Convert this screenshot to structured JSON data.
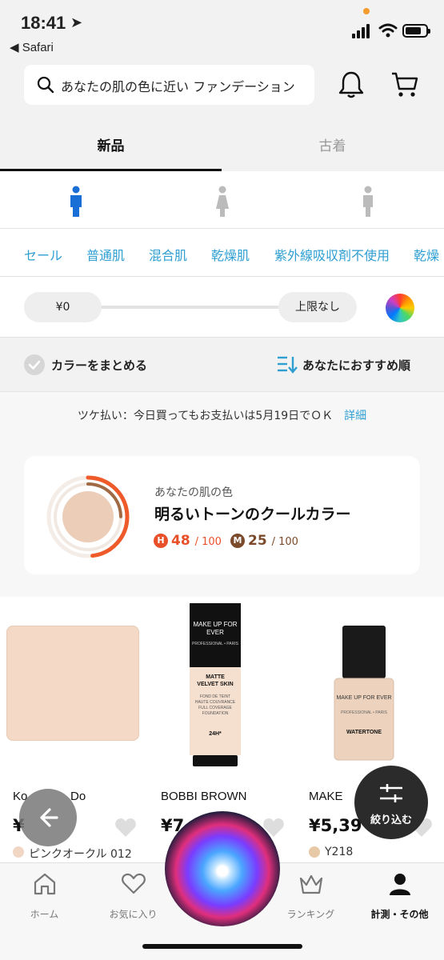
{
  "status": {
    "time": "18:41",
    "back_app": "◀ Safari",
    "battery_level": 0.8
  },
  "search": {
    "query": "あなたの肌の色に近い ファンデーション"
  },
  "tabs": [
    {
      "label": "新品"
    },
    {
      "label": "古着"
    }
  ],
  "categories": [
    "セール",
    "普通肌",
    "混合肌",
    "乾燥肌",
    "紫外線吸収剤不使用",
    "乾燥"
  ],
  "price_filter": {
    "min": "¥0",
    "max": "上限なし"
  },
  "sort": {
    "group_label": "カラーをまとめる",
    "order_label": "あなたにおすすめ順"
  },
  "notice": {
    "text": "ツケ払い：今日買ってもお支払いは5月19日でＯＫ",
    "link": "詳細"
  },
  "skin": {
    "label": "あなたの肌の色",
    "title": "明るいトーンのクールカラー",
    "h_badge": "H",
    "h_score": "48",
    "h_max": "/ 100",
    "m_badge": "M",
    "m_score": "25",
    "m_max": "/ 100"
  },
  "products": [
    {
      "brand": "Ko",
      "brand_tail": "Do",
      "price": "¥",
      "shade": "ピンクオークル 012",
      "swatch": "#f2d6c4"
    },
    {
      "brand": "BOBBI BROWN",
      "price": "¥7,",
      "shade": "",
      "swatch": "#e9cdb5",
      "tube_text": "MAKE UP FOR EVER",
      "tube_sub": "PROFESSIONAL • PARIS",
      "tube_product": "MATTE VELVET SKIN",
      "tube_desc": "FOND DE TEINT HAUTE COUVRANCE FULL COVERAGE FOUNDATION",
      "tube_hours": "24H*"
    },
    {
      "brand": "MAKE",
      "price": "¥5,39",
      "shade": "Y218",
      "swatch": "#e8c9a6",
      "bottle_text": "MAKE UP FOR EVER",
      "bottle_sub": "PROFESSIONAL • PARIS",
      "bottle_product": "WATERTONE"
    }
  ],
  "filter_button": {
    "label": "絞り込む"
  },
  "bottom_nav": [
    {
      "label": "ホーム"
    },
    {
      "label": "お気に入り"
    },
    {
      "label": ""
    },
    {
      "label": "ランキング"
    },
    {
      "label": "計測・その他"
    }
  ]
}
